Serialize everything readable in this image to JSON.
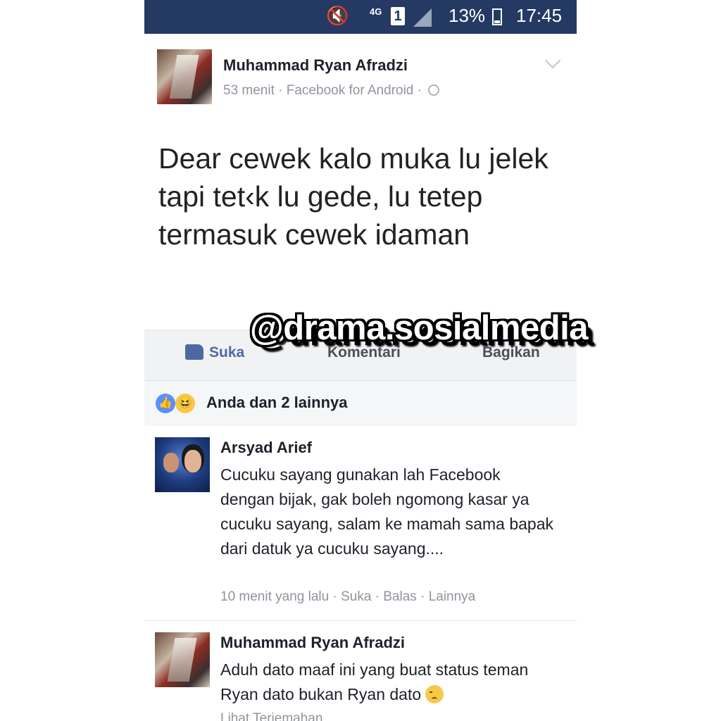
{
  "status_bar": {
    "network": "4G",
    "sim": "1",
    "battery": "13%",
    "time": "17:45"
  },
  "post": {
    "author": "Muhammad Ryan Afradzi",
    "meta": "53 menit · Facebook for Android ·",
    "text": "Dear cewek kalo muka lu jelek tapi tet‹k lu gede, lu tetep termasuk cewek idaman"
  },
  "actions": {
    "like": "Suka",
    "comment": "Komentari",
    "share": "Bagikan"
  },
  "watermark": "@drama.sosialmedia",
  "reactions": {
    "summary": "Anda dan 2 lainnya"
  },
  "comments": [
    {
      "author": "Arsyad Arief",
      "text": "Cucuku sayang gunakan lah Facebook dengan bijak, gak boleh ngomong kasar ya cucuku sayang, salam ke mamah sama bapak dari datuk ya cucuku sayang....",
      "meta": "10 menit yang lalu · Suka · Balas · Lainnya"
    },
    {
      "author": "Muhammad Ryan Afradzi",
      "text": "Aduh dato maaf ini yang buat status teman Ryan dato bukan Ryan dato",
      "more": "Lihat Terjemahan"
    }
  ]
}
